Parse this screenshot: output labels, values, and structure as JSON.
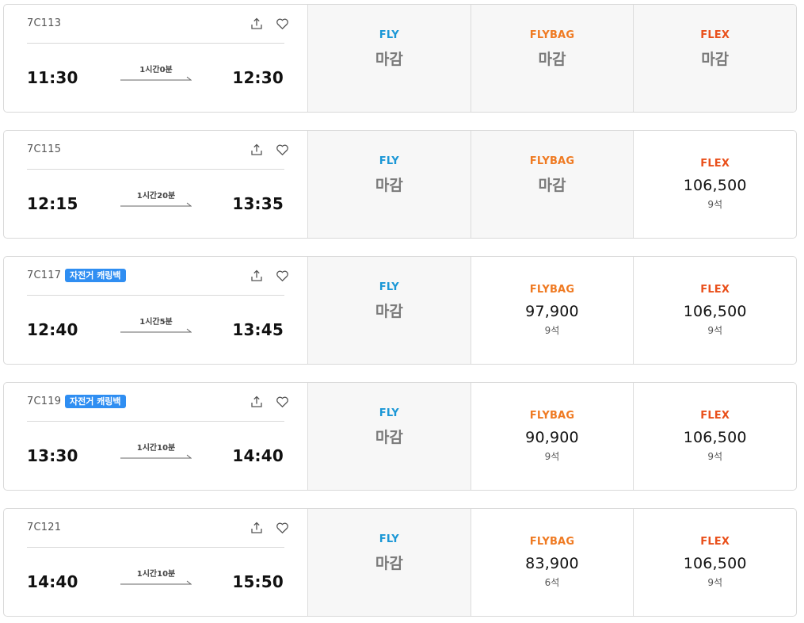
{
  "flights": [
    {
      "flight_no": "7C113",
      "badge": "",
      "departure": "11:30",
      "arrival": "12:30",
      "duration": "1시간0분",
      "fares": [
        {
          "name": "FLY",
          "status": "마감",
          "price": "",
          "seats": ""
        },
        {
          "name": "FLYBAG",
          "status": "마감",
          "price": "",
          "seats": ""
        },
        {
          "name": "FLEX",
          "status": "마감",
          "price": "",
          "seats": ""
        }
      ]
    },
    {
      "flight_no": "7C115",
      "badge": "",
      "departure": "12:15",
      "arrival": "13:35",
      "duration": "1시간20분",
      "fares": [
        {
          "name": "FLY",
          "status": "마감",
          "price": "",
          "seats": ""
        },
        {
          "name": "FLYBAG",
          "status": "마감",
          "price": "",
          "seats": ""
        },
        {
          "name": "FLEX",
          "status": "",
          "price": "106,500",
          "seats": "9석"
        }
      ]
    },
    {
      "flight_no": "7C117",
      "badge": "자전거 캐링백",
      "departure": "12:40",
      "arrival": "13:45",
      "duration": "1시간5분",
      "fares": [
        {
          "name": "FLY",
          "status": "마감",
          "price": "",
          "seats": ""
        },
        {
          "name": "FLYBAG",
          "status": "",
          "price": "97,900",
          "seats": "9석"
        },
        {
          "name": "FLEX",
          "status": "",
          "price": "106,500",
          "seats": "9석"
        }
      ]
    },
    {
      "flight_no": "7C119",
      "badge": "자전거 캐링백",
      "departure": "13:30",
      "arrival": "14:40",
      "duration": "1시간10분",
      "fares": [
        {
          "name": "FLY",
          "status": "마감",
          "price": "",
          "seats": ""
        },
        {
          "name": "FLYBAG",
          "status": "",
          "price": "90,900",
          "seats": "9석"
        },
        {
          "name": "FLEX",
          "status": "",
          "price": "106,500",
          "seats": "9석"
        }
      ]
    },
    {
      "flight_no": "7C121",
      "badge": "",
      "departure": "14:40",
      "arrival": "15:50",
      "duration": "1시간10분",
      "fares": [
        {
          "name": "FLY",
          "status": "마감",
          "price": "",
          "seats": ""
        },
        {
          "name": "FLYBAG",
          "status": "",
          "price": "83,900",
          "seats": "6석"
        },
        {
          "name": "FLEX",
          "status": "",
          "price": "106,500",
          "seats": "9석"
        }
      ]
    }
  ],
  "icons": {
    "share": "share-icon",
    "favorite": "heart-icon"
  },
  "colors": {
    "fly": "#1b97d6",
    "flybag": "#ef7a22",
    "flex": "#e9501b",
    "badge": "#2f8ef2",
    "closed_bg": "#f7f7f7"
  }
}
